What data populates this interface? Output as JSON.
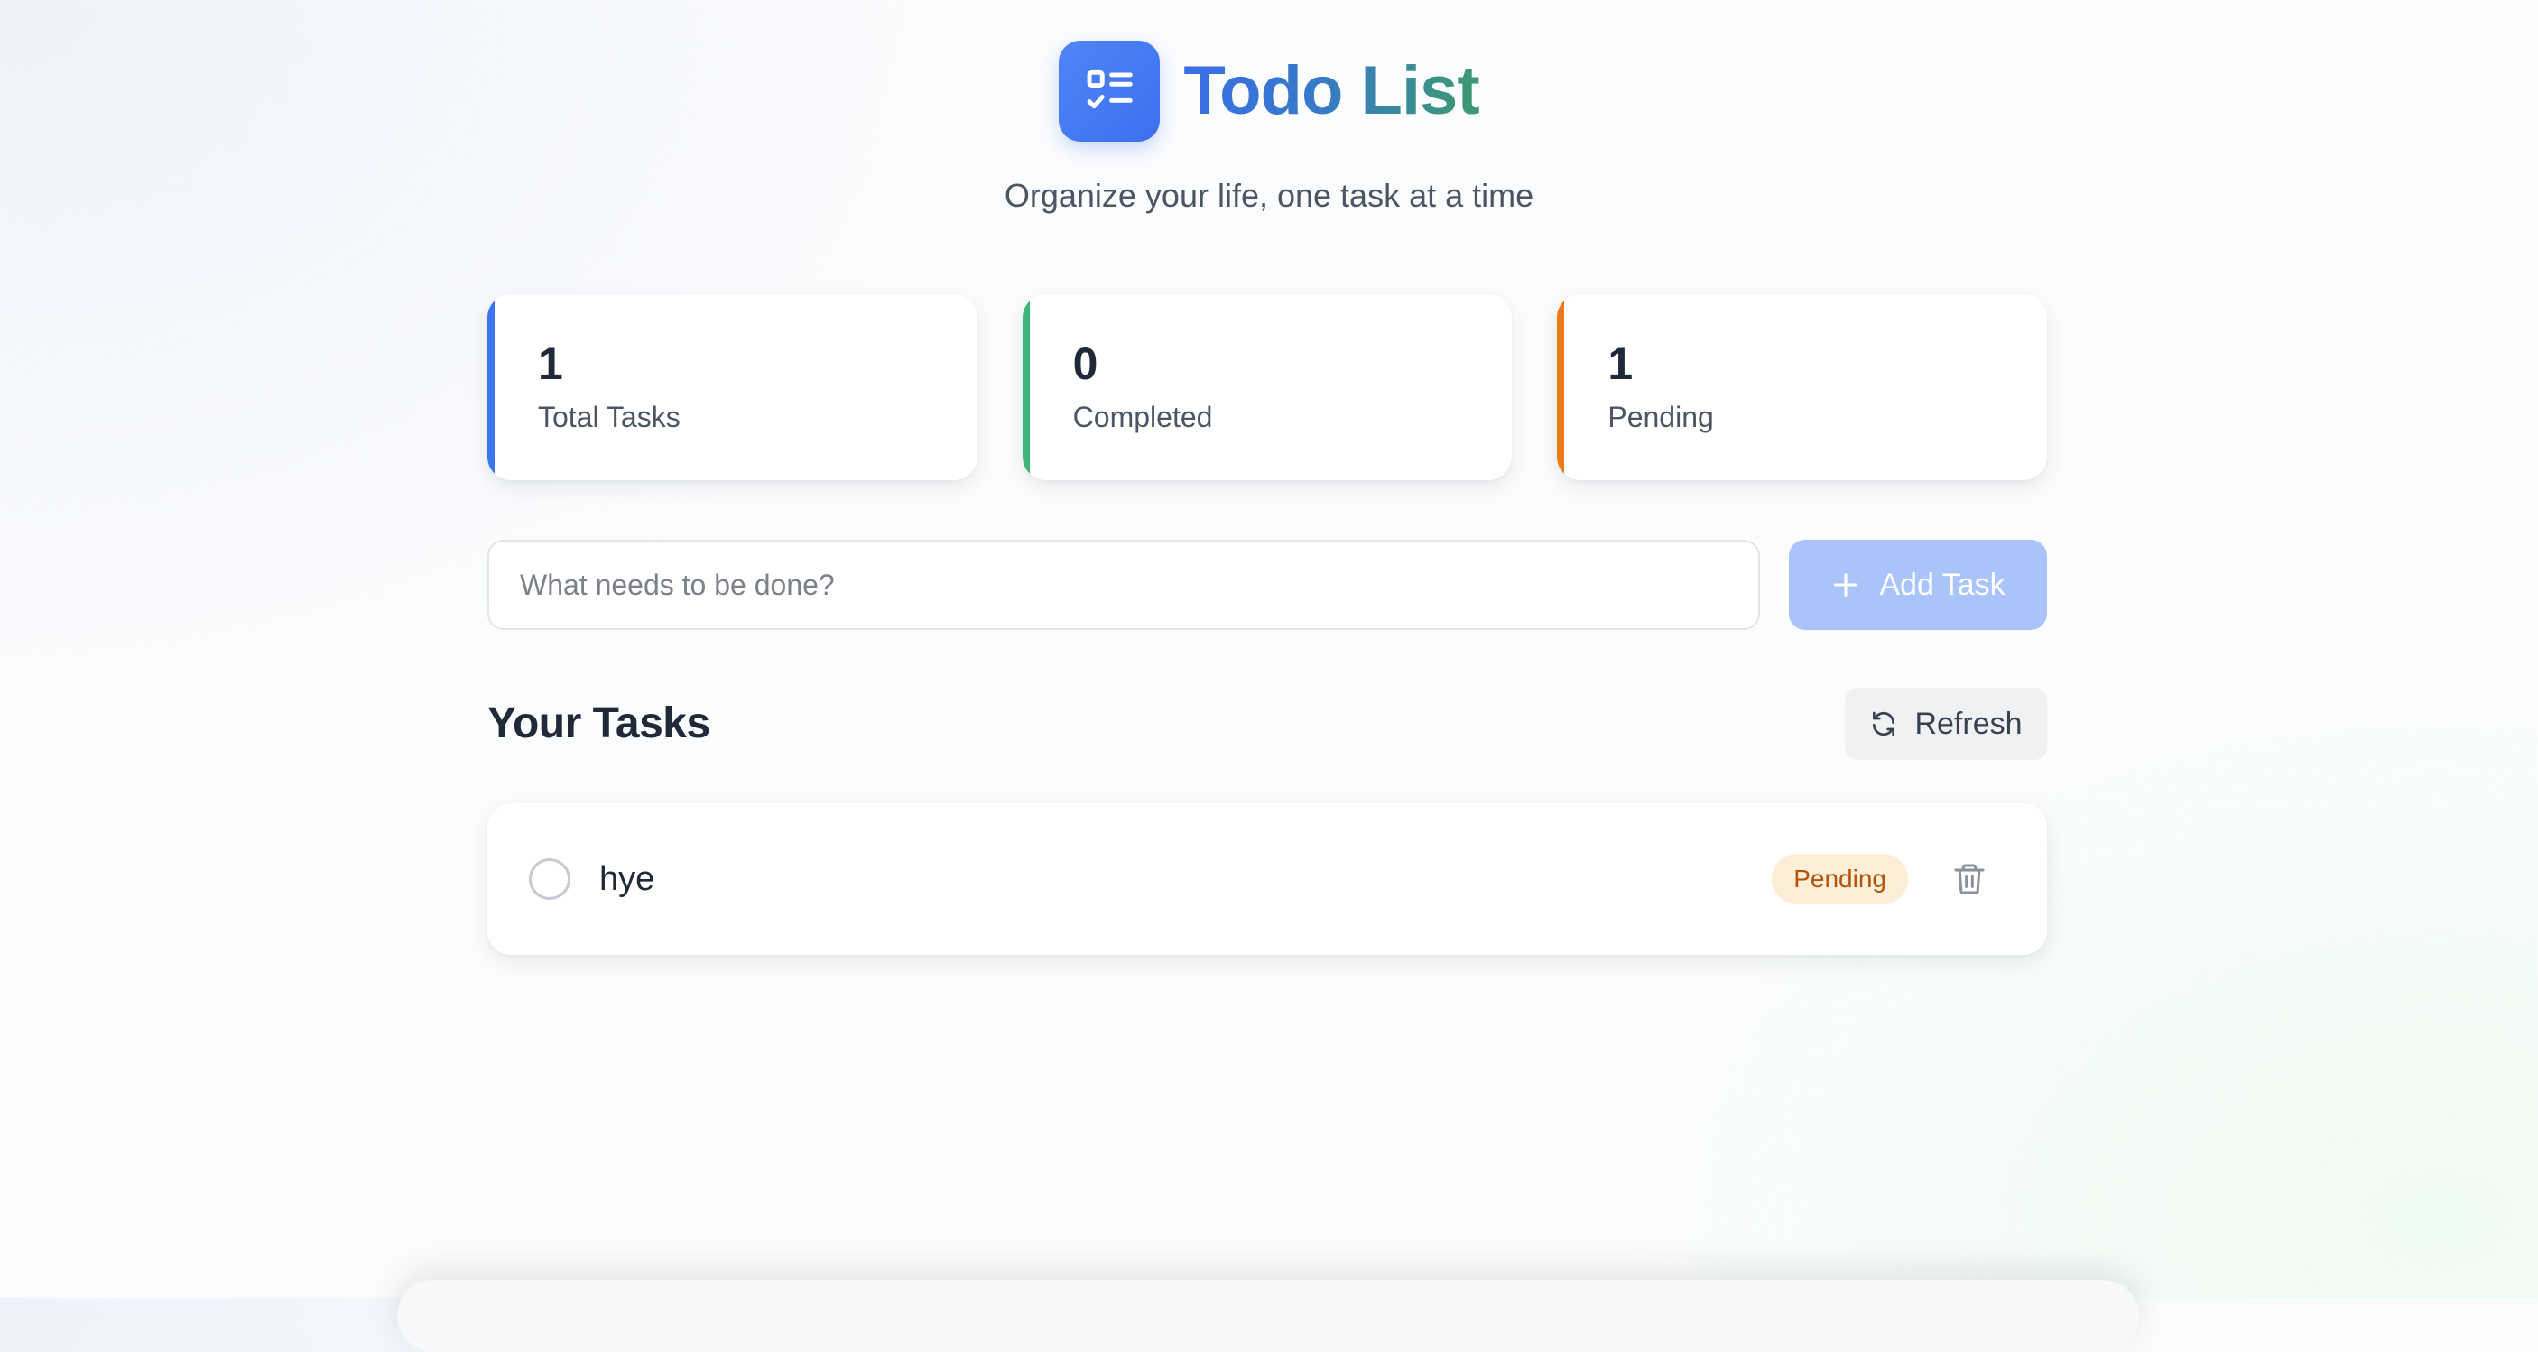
{
  "header": {
    "logo_icon": "checklist-icon",
    "title": "Todo List",
    "subtitle": "Organize your life, one task at a time"
  },
  "stats": [
    {
      "value": "1",
      "label": "Total Tasks",
      "accent": "#3b76f0"
    },
    {
      "value": "0",
      "label": "Completed",
      "accent": "#3fb47a"
    },
    {
      "value": "1",
      "label": "Pending",
      "accent": "#ee7a17"
    }
  ],
  "new_task": {
    "value": "",
    "placeholder": "What needs to be done?",
    "add_button_label": "Add Task",
    "add_button_icon": "plus-icon"
  },
  "tasks_section": {
    "title": "Your Tasks",
    "refresh_label": "Refresh",
    "refresh_icon": "refresh-icon"
  },
  "tasks": [
    {
      "text": "hye",
      "completed": false,
      "status": "Pending",
      "delete_icon": "trash-icon"
    }
  ],
  "colors": {
    "primary": "#3b76f0",
    "success": "#3fb47a",
    "warning": "#ee7a17",
    "badge_bg": "#fdeed8",
    "badge_text": "#b45309",
    "add_button_disabled": "#a9c4fb"
  }
}
